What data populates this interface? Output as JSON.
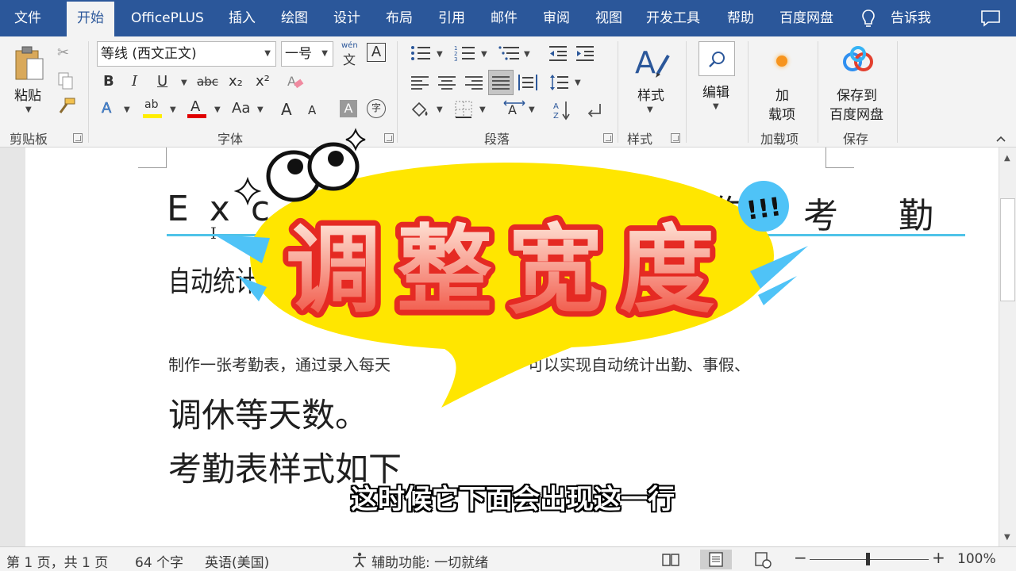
{
  "menu": {
    "tabs": [
      "文件",
      "开始",
      "OfficePLUS",
      "插入",
      "绘图",
      "设计",
      "布局",
      "引用",
      "邮件",
      "审阅",
      "视图",
      "开发工具",
      "帮助",
      "百度网盘"
    ],
    "active_tab": "开始",
    "tell_me": "告诉我"
  },
  "ribbon": {
    "clipboard": {
      "paste_label": "粘贴",
      "group_label": "剪贴板"
    },
    "font": {
      "font_name": "等线 (西文正文)",
      "font_size": "一号",
      "phonetic_top": "wén",
      "phonetic_bottom": "文",
      "border_char": "A",
      "bold": "B",
      "italic": "I",
      "underline": "U",
      "strike": "abc",
      "subscript": "x₂",
      "superscript": "x²",
      "effects": "A",
      "highlight": "ab",
      "font_color": "A",
      "case": "Aa",
      "grow": "A",
      "shrink": "A",
      "shading": "A",
      "enclose": "字",
      "group_label": "字体"
    },
    "paragraph": {
      "group_label": "段落"
    },
    "styles": {
      "label": "样式",
      "group_label": "样式"
    },
    "editing": {
      "label": "编辑"
    },
    "addins": {
      "label_1": "加",
      "label_2": "载项",
      "group_label": "加载项"
    },
    "baidu": {
      "label_1": "保存到",
      "label_2": "百度网盘",
      "group_label": "保存"
    }
  },
  "document": {
    "title_left": "E  x  c",
    "title_right_1": "作",
    "title_right_2": "考",
    "title_right_3": "勤",
    "subtitle_fragment": "自动统计",
    "para_small": "制作一张考勤表，通过录入每天",
    "para_small_right": "可以实现自动统计出勤、事假、",
    "para_large_1": "调休等天数。",
    "para_large_2": "考勤表样式如下"
  },
  "sticker": {
    "text": "调整宽度",
    "exclaim": "!!!"
  },
  "subtitle": "这时候它下面会出现这一行",
  "status": {
    "page": "第 1 页，共 1 页",
    "words": "64 个字",
    "language": "英语(美国)",
    "accessibility": "辅助功能: 一切就绪",
    "zoom_minus": "−",
    "zoom_plus": "+",
    "zoom": "100%"
  },
  "colors": {
    "brand": "#2b579a",
    "title_rule": "#4fc3e8",
    "sticker_fill": "#ffe600",
    "sticker_text_top": "#ffe9dc",
    "sticker_text_bottom": "#f04a3a",
    "sticker_outline": "#e52a23",
    "highlight": "#ffee00",
    "font_red": "#e00000"
  }
}
